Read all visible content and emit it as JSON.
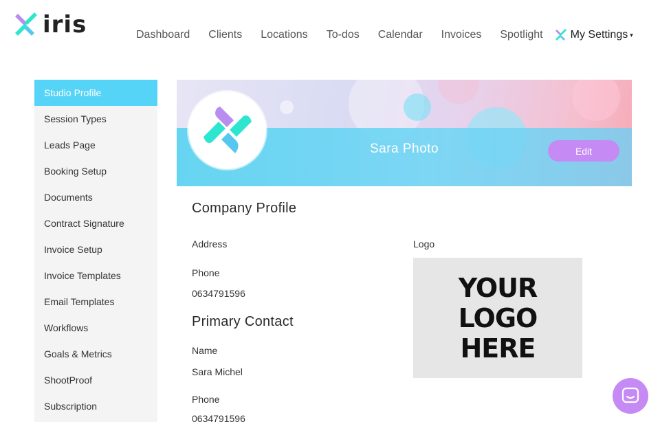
{
  "header": {
    "brand": "iris",
    "nav": [
      "Dashboard",
      "Clients",
      "Locations",
      "To-dos",
      "Calendar",
      "Invoices",
      "Spotlight"
    ],
    "settings_label": "My Settings",
    "settings_caret": "▾"
  },
  "sidebar": {
    "items": [
      {
        "label": "Studio Profile",
        "active": true
      },
      {
        "label": "Session Types"
      },
      {
        "label": "Leads Page"
      },
      {
        "label": "Booking Setup"
      },
      {
        "label": "Documents"
      },
      {
        "label": "Contract Signature"
      },
      {
        "label": "Invoice Setup"
      },
      {
        "label": "Invoice Templates"
      },
      {
        "label": "Email Templates"
      },
      {
        "label": "Workflows"
      },
      {
        "label": "Goals & Metrics"
      },
      {
        "label": "ShootProof"
      },
      {
        "label": "Subscription"
      }
    ]
  },
  "banner": {
    "studio_name": "Sara Photo",
    "edit_label": "Edit"
  },
  "company": {
    "heading": "Company Profile",
    "address_label": "Address",
    "phone_label": "Phone",
    "phone_value": "0634791596",
    "logo_label": "Logo",
    "logo_placeholder": "YOUR\nLOGO\nHERE"
  },
  "contact": {
    "heading": "Primary Contact",
    "name_label": "Name",
    "name_value": "Sara Michel",
    "phone_label": "Phone",
    "phone_value": "0634791596"
  },
  "colors": {
    "accent_cyan": "#56d4f7",
    "accent_purple": "#c58af4",
    "brand_teal": "#2ee6d0"
  },
  "icons": {
    "brand_logo": "iris-pinwheel-icon",
    "settings": "iris-pinwheel-icon",
    "chat": "chat-bubble-icon"
  }
}
